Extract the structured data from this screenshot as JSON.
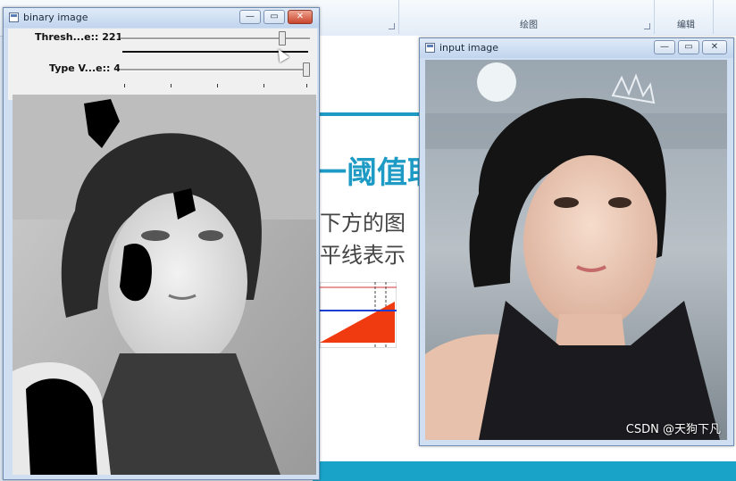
{
  "ribbon": {
    "groups": [
      {
        "label": ""
      },
      {
        "label": "绘图"
      },
      {
        "label": "编辑"
      }
    ]
  },
  "slide": {
    "heading": "一阈值取",
    "line1": "下方的图",
    "line2": "平线表示"
  },
  "binary_window": {
    "title": "binary image",
    "trackbars": [
      {
        "label": "Thresh...e:: 221",
        "value": 221,
        "max": 255
      },
      {
        "label": "Type V...e:: 4",
        "value": 4,
        "max": 4
      }
    ]
  },
  "input_window": {
    "title": "input image"
  },
  "buttons": {
    "minimize": "—",
    "maximize": "▭",
    "close": "✕"
  },
  "watermark": "CSDN @天狗下凡",
  "colors": {
    "accent": "#1e9bc4",
    "close_red": "#c9462d",
    "chart_red": "#f03a10",
    "chart_blue": "#1a3fd0"
  }
}
